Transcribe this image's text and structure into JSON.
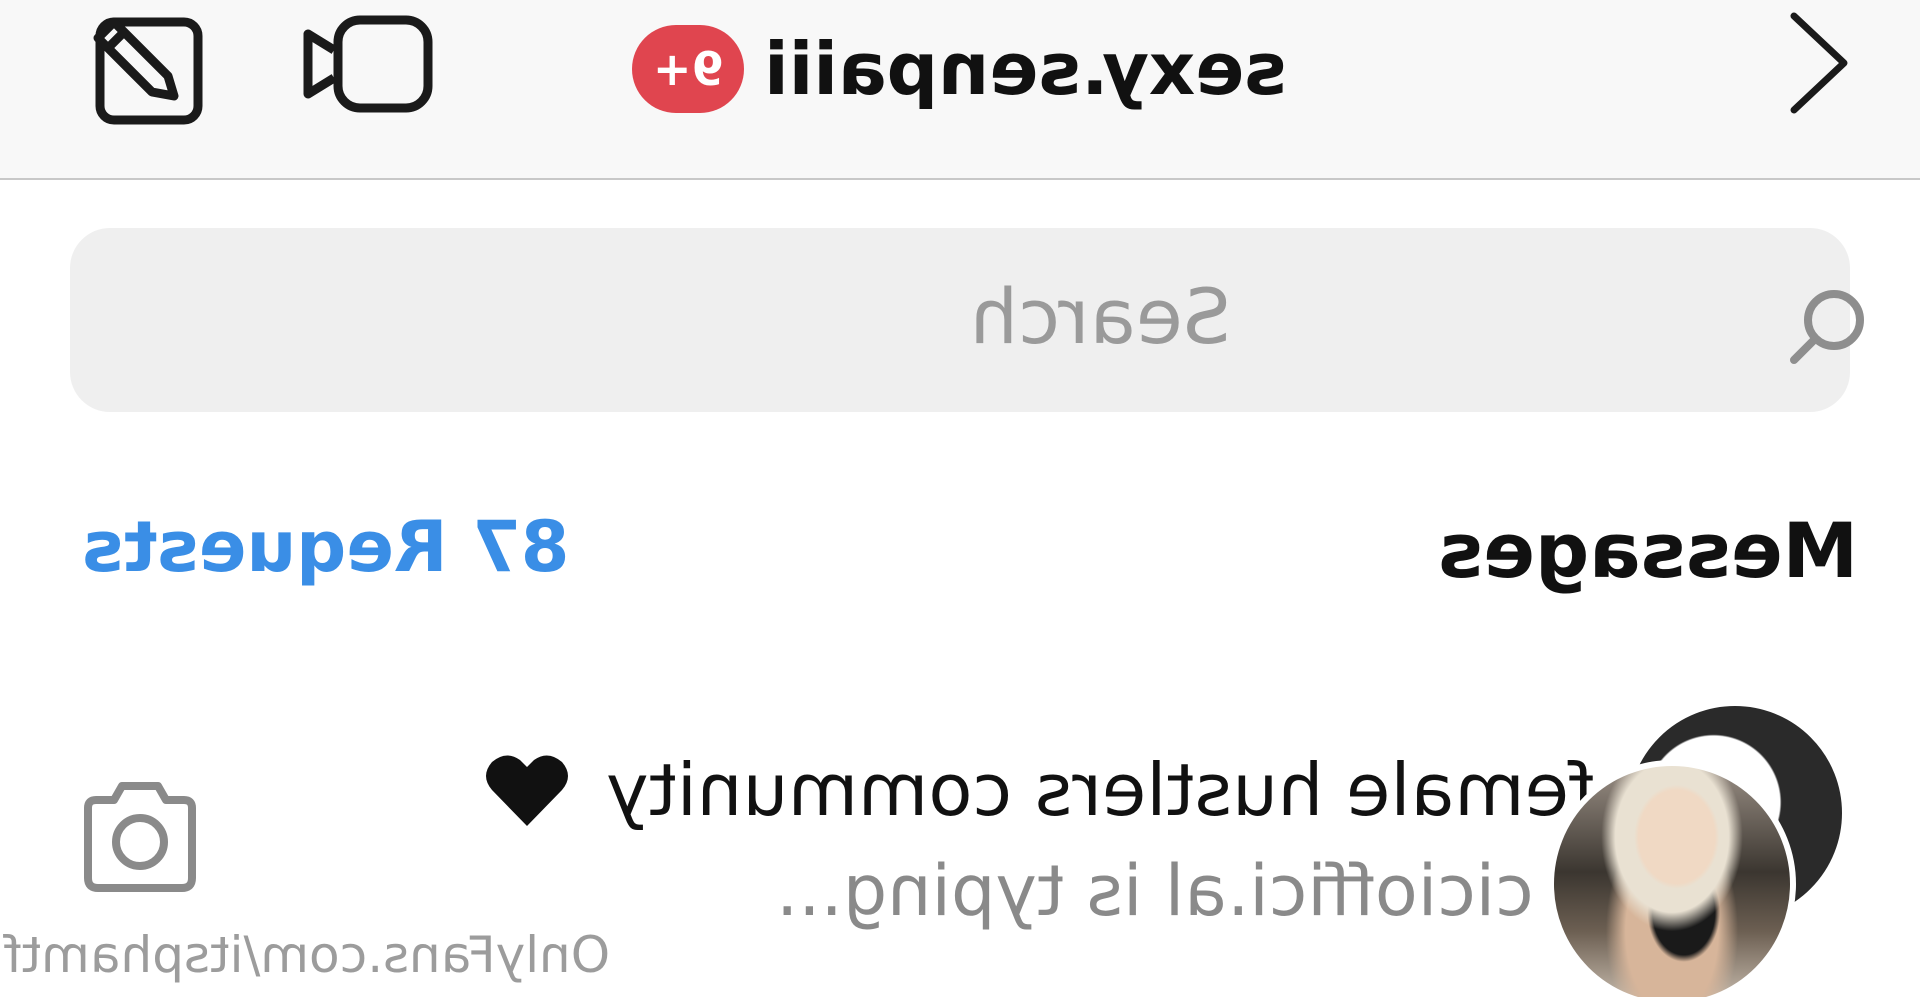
{
  "header": {
    "account_title": "sexy.senpaiii",
    "notification_badge": "9+",
    "badge_color": "#e0454f",
    "icons": [
      "compose-icon",
      "video-camera-icon",
      "chevron-right-icon"
    ]
  },
  "search": {
    "placeholder": "Search",
    "icon": "search-icon"
  },
  "section": {
    "heading": "Messages",
    "requests_label": "87 Requests",
    "link_color": "#3a8ee6"
  },
  "conversations": [
    {
      "name": "female hustlers community",
      "emoji": "black-heart-icon",
      "status": "cicioffici.al is typing...",
      "action_icon": "camera-icon"
    }
  ],
  "watermark": "OnlyFans.com/itsphamtf"
}
